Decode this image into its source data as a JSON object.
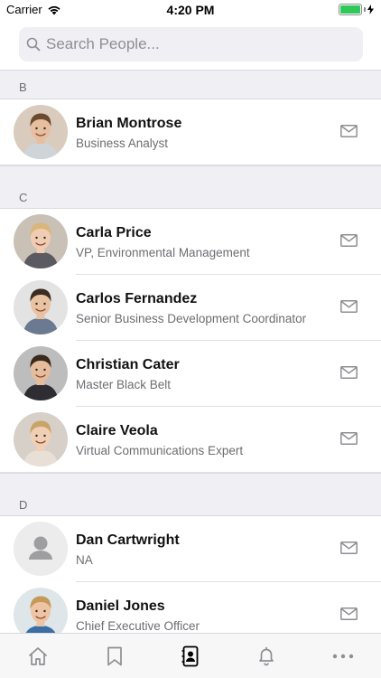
{
  "status_bar": {
    "carrier": "Carrier",
    "time": "4:20 PM",
    "battery_percent": 100,
    "battery_color": "#2fc95a"
  },
  "search": {
    "placeholder": "Search People..."
  },
  "sections": [
    {
      "letter": "B",
      "people": [
        {
          "name": "Brian Montrose",
          "title": "Business Analyst",
          "avatar": "photo"
        }
      ]
    },
    {
      "letter": "C",
      "people": [
        {
          "name": "Carla Price",
          "title": "VP, Environmental Management",
          "avatar": "photo"
        },
        {
          "name": "Carlos Fernandez",
          "title": "Senior Business Development Coordinator",
          "avatar": "photo"
        },
        {
          "name": "Christian Cater",
          "title": "Master Black Belt",
          "avatar": "photo"
        },
        {
          "name": "Claire Veola",
          "title": "Virtual Communications Expert",
          "avatar": "photo"
        }
      ]
    },
    {
      "letter": "D",
      "people": [
        {
          "name": "Dan Cartwright",
          "title": "NA",
          "avatar": "placeholder"
        },
        {
          "name": "Daniel Jones",
          "title": "Chief Executive Officer",
          "avatar": "photo"
        }
      ]
    }
  ],
  "row_action_icon": "mail-icon",
  "tab_bar": {
    "tabs": [
      {
        "icon": "home-icon",
        "active": false
      },
      {
        "icon": "bookmark-icon",
        "active": false
      },
      {
        "icon": "contacts-icon",
        "active": true
      },
      {
        "icon": "bell-icon",
        "active": false
      },
      {
        "icon": "more-icon",
        "active": false
      }
    ]
  },
  "colors": {
    "accent": "#000000",
    "section_bg": "#efeff4",
    "secondary_text": "#6d6d72",
    "icon_gray": "#8e8e93"
  }
}
